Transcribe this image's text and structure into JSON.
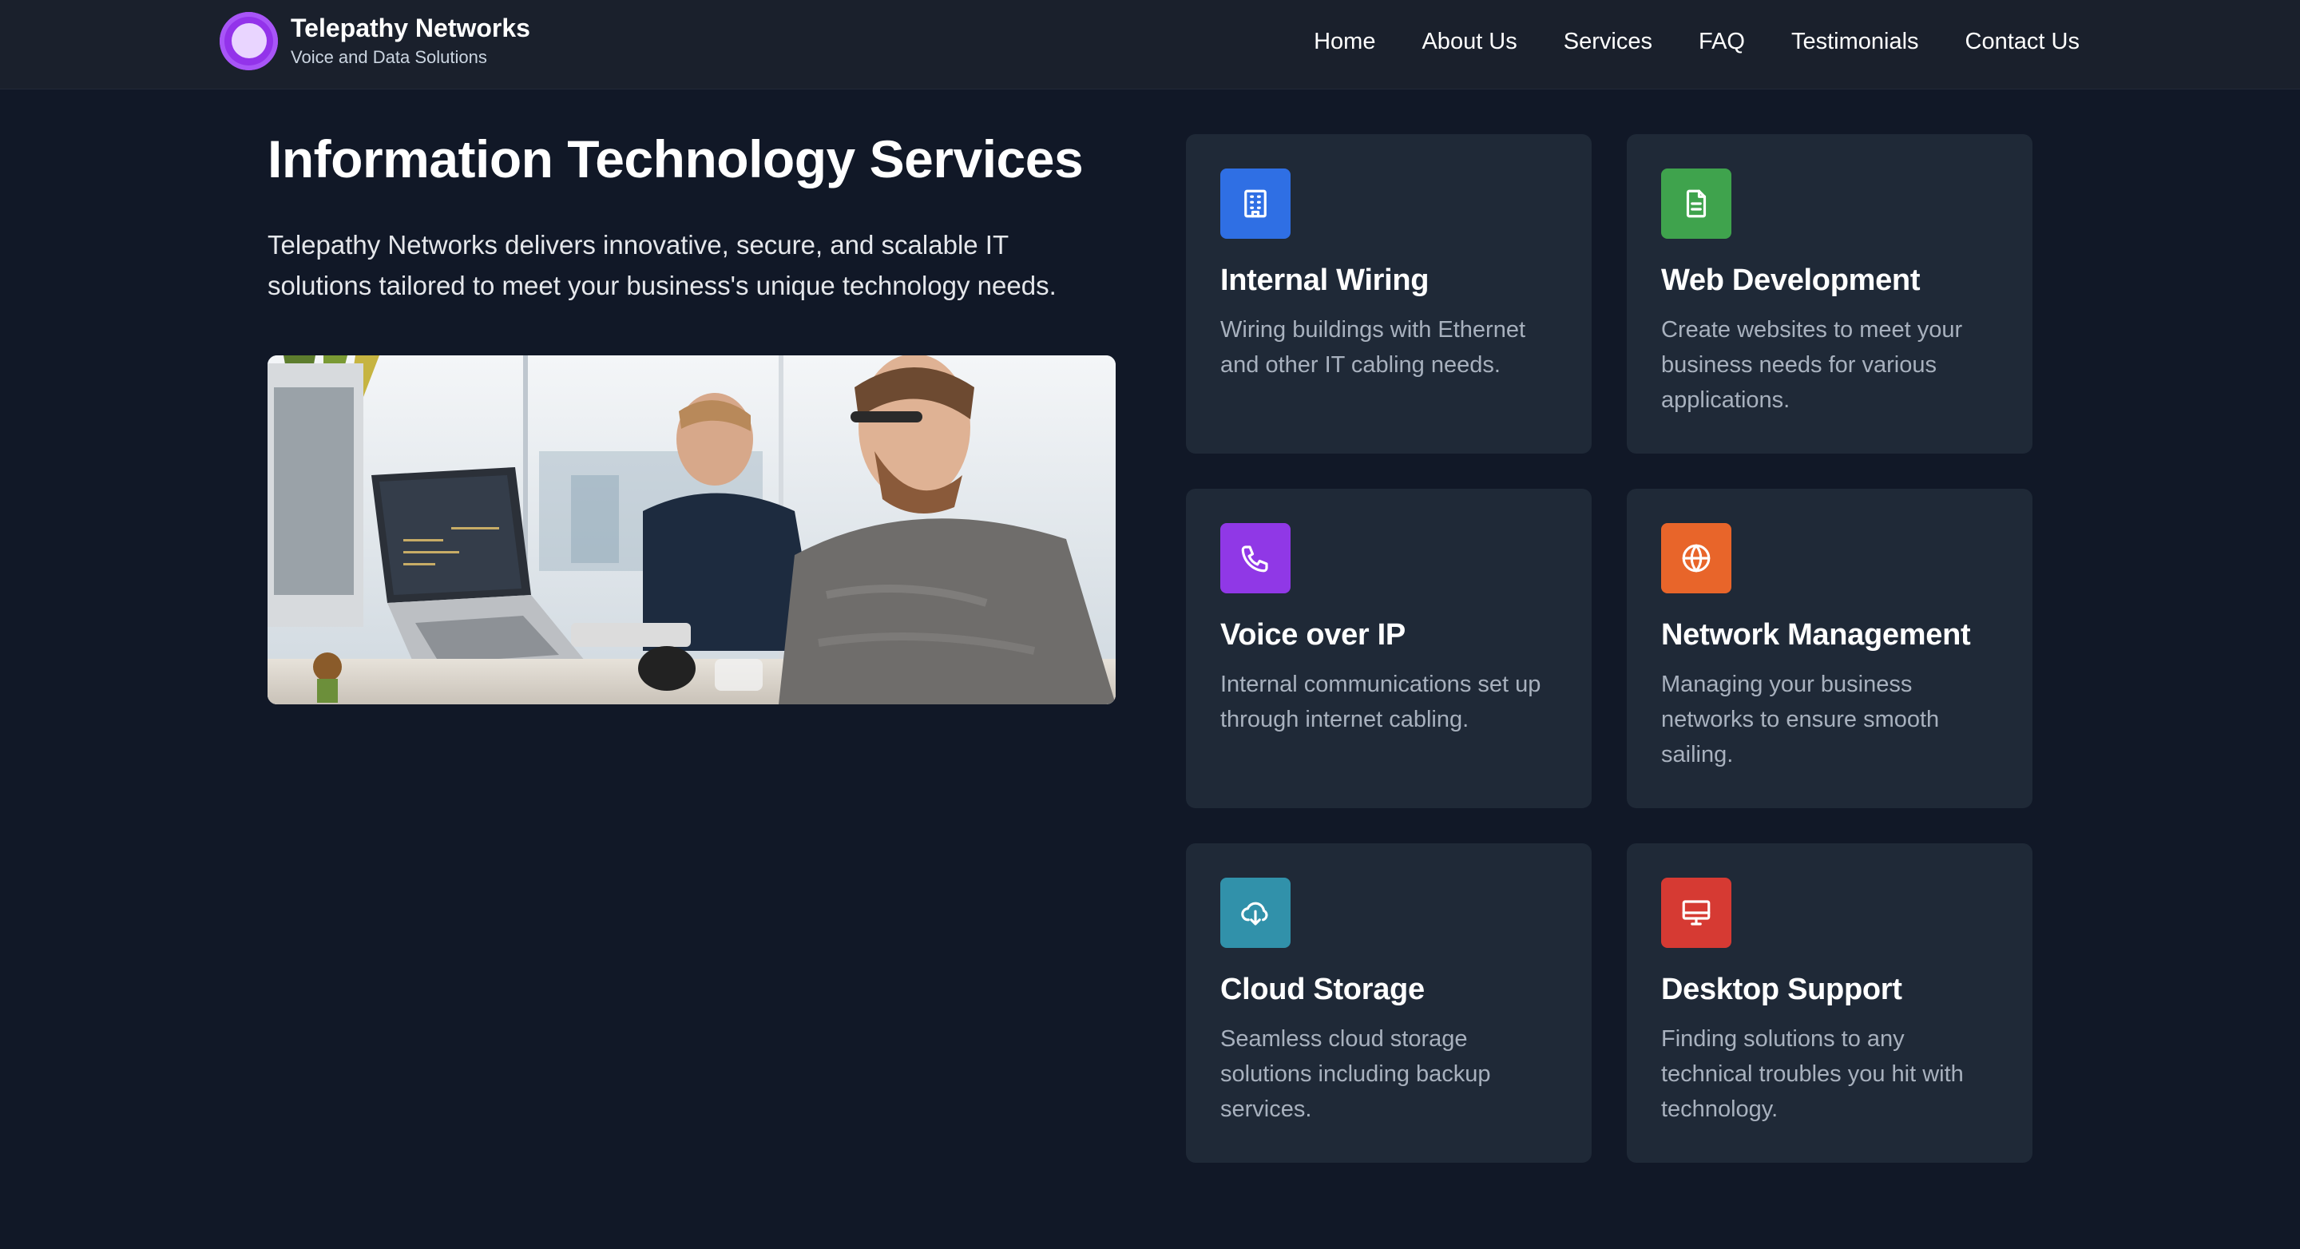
{
  "header": {
    "brand_name": "Telepathy Networks",
    "brand_tagline": "Voice and Data Solutions",
    "nav": [
      {
        "label": "Home"
      },
      {
        "label": "About Us"
      },
      {
        "label": "Services"
      },
      {
        "label": "FAQ"
      },
      {
        "label": "Testimonials"
      },
      {
        "label": "Contact Us"
      }
    ]
  },
  "hero": {
    "title": "Information Technology Services",
    "description": "Telepathy Networks delivers innovative, secure, and scalable IT solutions tailored to meet your business's unique technology needs."
  },
  "services": [
    {
      "title": "Internal Wiring",
      "description": "Wiring buildings with Ethernet and other IT cabling needs.",
      "icon": "building-icon",
      "color": "#2f6fe4"
    },
    {
      "title": "Web Development",
      "description": "Create websites to meet your business needs for various applications.",
      "icon": "document-icon",
      "color": "#3fa34d"
    },
    {
      "title": "Voice over IP",
      "description": "Internal communications set up through internet cabling.",
      "icon": "phone-icon",
      "color": "#9038e6"
    },
    {
      "title": "Network Management",
      "description": "Managing your business networks to ensure smooth sailing.",
      "icon": "globe-icon",
      "color": "#e8652a"
    },
    {
      "title": "Cloud Storage",
      "description": "Seamless cloud storage solutions including backup services.",
      "icon": "cloud-download-icon",
      "color": "#3191aa"
    },
    {
      "title": "Desktop Support",
      "description": "Finding solutions to any technical troubles you hit with technology.",
      "icon": "desktop-icon",
      "color": "#d63a33"
    }
  ],
  "colors": {
    "page_bg": "#111827",
    "header_bg": "#1a202c",
    "card_bg": "#1f2937",
    "brand_purple": "#9333ea"
  }
}
